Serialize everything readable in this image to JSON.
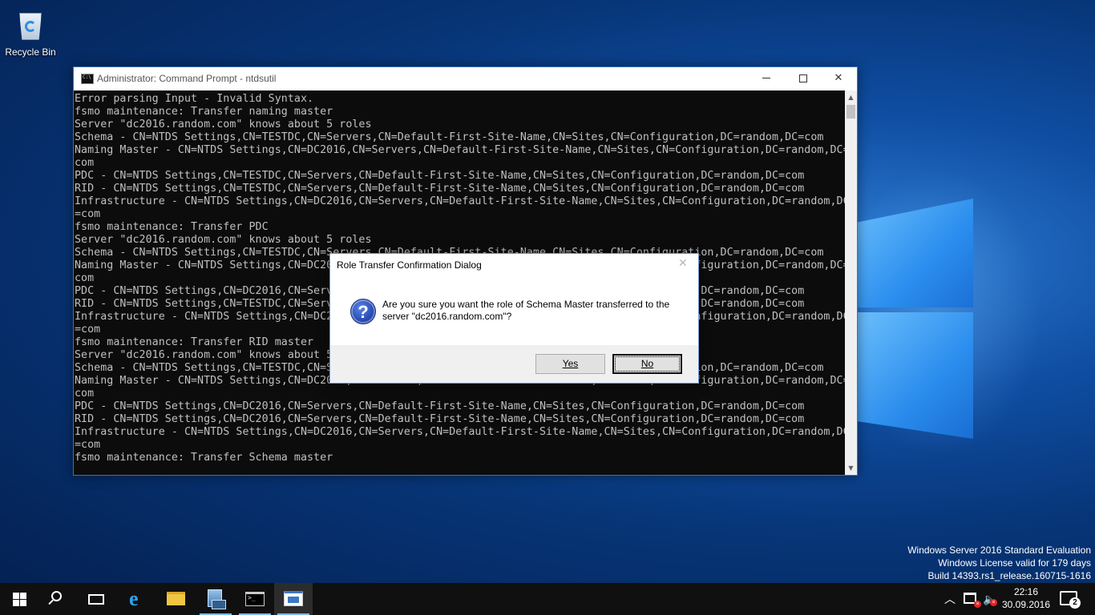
{
  "desktop": {
    "icons": [
      {
        "label": "Recycle Bin",
        "icon": "recycle-bin-icon"
      }
    ],
    "watermark": {
      "line1": "Windows Server 2016 Standard Evaluation",
      "line2": "Windows License valid for 179 days",
      "line3": "Build 14393.rs1_release.160715-1616"
    }
  },
  "cmd_window": {
    "title": "Administrator: Command Prompt - ntdsutil",
    "controls": {
      "minimize": "minimize-icon",
      "maximize": "maximize-icon",
      "close": "close-icon"
    },
    "lines": [
      "Error parsing Input - Invalid Syntax.",
      "fsmo maintenance: Transfer naming master",
      "Server \"dc2016.random.com\" knows about 5 roles",
      "Schema - CN=NTDS Settings,CN=TESTDC,CN=Servers,CN=Default-First-Site-Name,CN=Sites,CN=Configuration,DC=random,DC=com",
      "Naming Master - CN=NTDS Settings,CN=DC2016,CN=Servers,CN=Default-First-Site-Name,CN=Sites,CN=Configuration,DC=random,DC=",
      "com",
      "PDC - CN=NTDS Settings,CN=TESTDC,CN=Servers,CN=Default-First-Site-Name,CN=Sites,CN=Configuration,DC=random,DC=com",
      "RID - CN=NTDS Settings,CN=TESTDC,CN=Servers,CN=Default-First-Site-Name,CN=Sites,CN=Configuration,DC=random,DC=com",
      "Infrastructure - CN=NTDS Settings,CN=DC2016,CN=Servers,CN=Default-First-Site-Name,CN=Sites,CN=Configuration,DC=random,DC",
      "=com",
      "fsmo maintenance: Transfer PDC",
      "Server \"dc2016.random.com\" knows about 5 roles",
      "Schema - CN=NTDS Settings,CN=TESTDC,CN=Servers,CN=Default-First-Site-Name,CN=Sites,CN=Configuration,DC=random,DC=com",
      "Naming Master - CN=NTDS Settings,CN=DC2016,CN=Servers,CN=Default-First-Site-Name,CN=Sites,CN=Configuration,DC=random,DC=",
      "com",
      "PDC - CN=NTDS Settings,CN=DC2016,CN=Servers,CN=Default-First-Site-Name,CN=Sites,CN=Configuration,DC=random,DC=com",
      "RID - CN=NTDS Settings,CN=TESTDC,CN=Servers,CN=Default-First-Site-Name,CN=Sites,CN=Configuration,DC=random,DC=com",
      "Infrastructure - CN=NTDS Settings,CN=DC2016,CN=Servers,CN=Default-First-Site-Name,CN=Sites,CN=Configuration,DC=random,DC",
      "=com",
      "fsmo maintenance: Transfer RID master",
      "Server \"dc2016.random.com\" knows about 5 roles",
      "Schema - CN=NTDS Settings,CN=TESTDC,CN=Servers,CN=Default-First-Site-Name,CN=Sites,CN=Configuration,DC=random,DC=com",
      "Naming Master - CN=NTDS Settings,CN=DC2016,CN=Servers,CN=Default-First-Site-Name,CN=Sites,CN=Configuration,DC=random,DC=",
      "com",
      "PDC - CN=NTDS Settings,CN=DC2016,CN=Servers,CN=Default-First-Site-Name,CN=Sites,CN=Configuration,DC=random,DC=com",
      "RID - CN=NTDS Settings,CN=DC2016,CN=Servers,CN=Default-First-Site-Name,CN=Sites,CN=Configuration,DC=random,DC=com",
      "Infrastructure - CN=NTDS Settings,CN=DC2016,CN=Servers,CN=Default-First-Site-Name,CN=Sites,CN=Configuration,DC=random,DC",
      "=com",
      "fsmo maintenance: Transfer Schema master"
    ]
  },
  "dialog": {
    "title": "Role Transfer Confirmation Dialog",
    "icon": "question-icon",
    "message_line1": "Are you sure you want the role of Schema Master transferred to the",
    "message_line2": "server \"dc2016.random.com\"?",
    "yes_label": "Yes",
    "no_label": "No"
  },
  "taskbar": {
    "items": [
      "start-icon",
      "search-icon",
      "task-view-icon",
      "internet-explorer-icon",
      "file-explorer-icon",
      "server-manager-icon",
      "command-prompt-icon",
      "dialog-app-icon"
    ],
    "time": "22:16",
    "date": "30.09.2016",
    "notification_count": "2"
  }
}
